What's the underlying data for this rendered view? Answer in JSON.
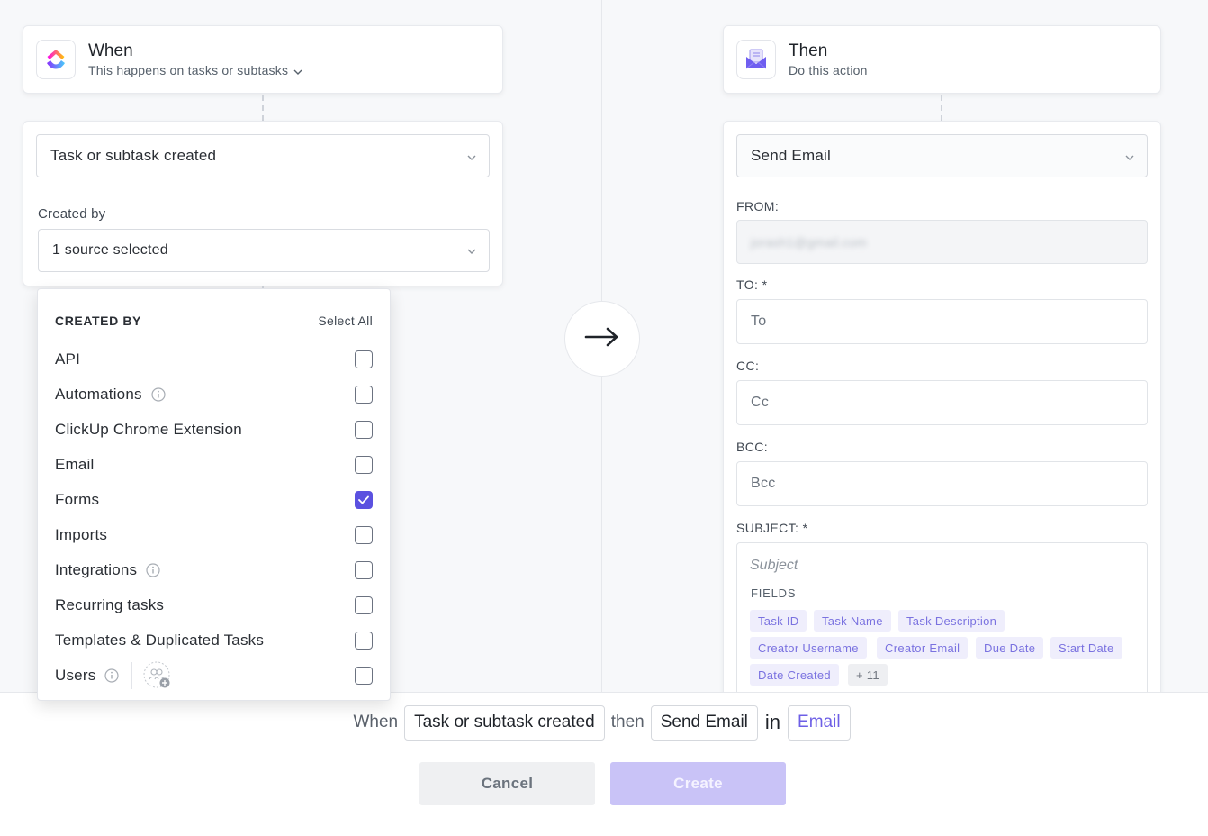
{
  "trigger": {
    "title": "When",
    "subtitle": "This happens on tasks or subtasks",
    "event_value": "Task or subtask created",
    "created_by_label": "Created by",
    "created_by_value": "1 source selected"
  },
  "dropdown": {
    "title": "CREATED BY",
    "select_all": "Select All",
    "items": [
      {
        "label": "API",
        "checked": false,
        "info": false
      },
      {
        "label": "Automations",
        "checked": false,
        "info": true
      },
      {
        "label": "ClickUp Chrome Extension",
        "checked": false,
        "info": false
      },
      {
        "label": "Email",
        "checked": false,
        "info": false
      },
      {
        "label": "Forms",
        "checked": true,
        "info": false
      },
      {
        "label": "Imports",
        "checked": false,
        "info": false
      },
      {
        "label": "Integrations",
        "checked": false,
        "info": true
      },
      {
        "label": "Recurring tasks",
        "checked": false,
        "info": false
      },
      {
        "label": "Templates & Duplicated Tasks",
        "checked": false,
        "info": false
      },
      {
        "label": "Users",
        "checked": false,
        "info": true
      }
    ]
  },
  "action": {
    "title": "Then",
    "subtitle": "Do this action",
    "action_value": "Send Email",
    "from_label": "FROM:",
    "from_value": "jorash1@gmail.com",
    "to_label": "TO: *",
    "to_placeholder": "To",
    "cc_label": "CC:",
    "cc_placeholder": "Cc",
    "bcc_label": "BCC:",
    "bcc_placeholder": "Bcc",
    "subject_label": "SUBJECT: *",
    "subject_placeholder": "Subject",
    "fields_label": "FIELDS",
    "fields": [
      "Task ID",
      "Task Name",
      "Task Description",
      "Creator Username",
      "Creator Email",
      "Due Date",
      "Start Date",
      "Date Created"
    ],
    "more_fields": "+ 11"
  },
  "summary": {
    "when": "When",
    "trigger": "Task or subtask created",
    "then": "then",
    "action": "Send Email",
    "in": "in",
    "location": "Email"
  },
  "buttons": {
    "cancel": "Cancel",
    "create": "Create"
  },
  "colors": {
    "accent": "#5b51e0",
    "chip_bg": "#efeefc",
    "chip_text": "#7a72e0",
    "create_disabled": "#c9c3f7"
  }
}
